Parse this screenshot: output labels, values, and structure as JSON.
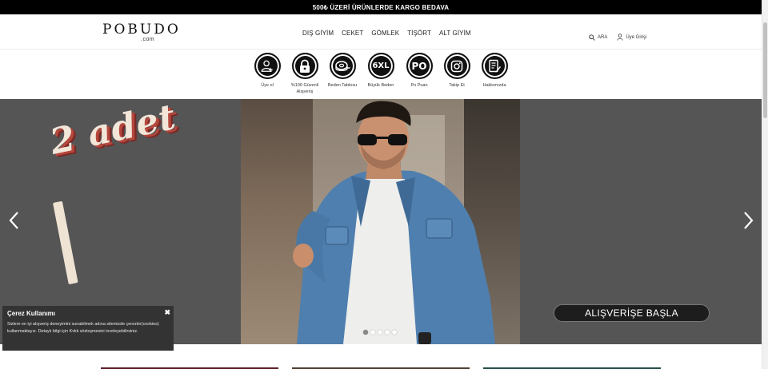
{
  "topbar": {
    "text": "500₺ ÜZERİ ÜRÜNLERDE KARGO BEDAVA"
  },
  "logo": {
    "main": "POBUDO",
    "sub": ".com"
  },
  "nav": [
    {
      "label": "DIŞ GİYİM"
    },
    {
      "label": "CEKET"
    },
    {
      "label": "GÖMLEK"
    },
    {
      "label": "TİŞÖRT"
    },
    {
      "label": "ALT GİYİM"
    }
  ],
  "header_right": {
    "search_label": "ARA",
    "account_label": "Üye Girişi"
  },
  "icon_bar": [
    {
      "icon": "user-plus-icon",
      "label": "Üye ol"
    },
    {
      "icon": "lock-icon",
      "label": "%100 Güvenli Alışveriş"
    },
    {
      "icon": "tape-measure-icon",
      "label": "Beden Tablosu"
    },
    {
      "icon": "6xl-icon",
      "glyph": "6XL",
      "label": "Büyük Beden"
    },
    {
      "icon": "po-icon",
      "glyph": "PO",
      "label": "Po Puan"
    },
    {
      "icon": "instagram-icon",
      "label": "Takip Et"
    },
    {
      "icon": "about-icon",
      "label": "Hakkımızda"
    }
  ],
  "hero": {
    "promo_text": "2 adet",
    "cta_label": "ALIŞVERİŞE BAŞLA",
    "slides": 5,
    "active_slide": 1
  },
  "cookie": {
    "title": "Çerez Kullanımı",
    "body": "Sizlere en iyi alışveriş deneyimini sunabilmek adına sitemizde çerezler(cookies) kullanmaktayız. Detaylı bilgi için Kvkk sözleşmesini inceleyebilirsiniz.",
    "close": "✖"
  },
  "colors": {
    "topbar_bg": "#000000",
    "hero_bg": "#555556",
    "cta_bg": "#1d1d1d",
    "cookie_bg": "#333333",
    "card_1": "#5a1a22",
    "card_2": "#4a3a2e",
    "card_3": "#1f4a48"
  }
}
